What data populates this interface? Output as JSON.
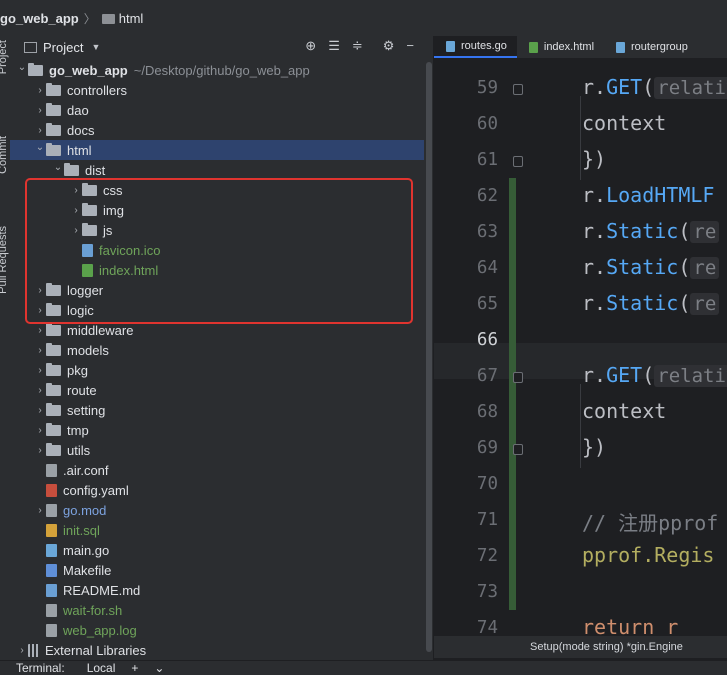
{
  "breadcrumb": {
    "project": "go_web_app",
    "folder": "html"
  },
  "side_strip": {
    "project_label": "Project",
    "commit_label": "Commit",
    "pull_label": "Pull Requests"
  },
  "project_panel": {
    "title": "Project",
    "tools": [
      "crosshair-icon",
      "expand-all-icon",
      "collapse-all-icon",
      "settings-icon"
    ],
    "tree": [
      {
        "indent": 0,
        "arrow": "open",
        "type": "folder",
        "label": "go_web_app",
        "bold": true,
        "suffix": "~/Desktop/github/go_web_app"
      },
      {
        "indent": 1,
        "arrow": "closed",
        "type": "folder",
        "label": "controllers"
      },
      {
        "indent": 1,
        "arrow": "closed",
        "type": "folder",
        "label": "dao"
      },
      {
        "indent": 1,
        "arrow": "closed",
        "type": "folder",
        "label": "docs"
      },
      {
        "indent": 1,
        "arrow": "open",
        "type": "folder",
        "label": "html",
        "selected": true
      },
      {
        "indent": 2,
        "arrow": "open",
        "type": "folder",
        "label": "dist"
      },
      {
        "indent": 3,
        "arrow": "closed",
        "type": "folder",
        "label": "css"
      },
      {
        "indent": 3,
        "arrow": "closed",
        "type": "folder",
        "label": "img"
      },
      {
        "indent": 3,
        "arrow": "closed",
        "type": "folder",
        "label": "js"
      },
      {
        "indent": 3,
        "arrow": "none",
        "type": "file",
        "label": "favicon.ico",
        "color": "green",
        "icon": "#6a9fd4"
      },
      {
        "indent": 3,
        "arrow": "none",
        "type": "file",
        "label": "index.html",
        "color": "green",
        "icon": "#5aa14b"
      },
      {
        "indent": 1,
        "arrow": "closed",
        "type": "folder",
        "label": "logger"
      },
      {
        "indent": 1,
        "arrow": "closed",
        "type": "folder",
        "label": "logic"
      },
      {
        "indent": 1,
        "arrow": "closed",
        "type": "folder",
        "label": "middleware"
      },
      {
        "indent": 1,
        "arrow": "closed",
        "type": "folder",
        "label": "models"
      },
      {
        "indent": 1,
        "arrow": "closed",
        "type": "folder",
        "label": "pkg"
      },
      {
        "indent": 1,
        "arrow": "closed",
        "type": "folder",
        "label": "route"
      },
      {
        "indent": 1,
        "arrow": "closed",
        "type": "folder",
        "label": "setting"
      },
      {
        "indent": 1,
        "arrow": "closed",
        "type": "folder",
        "label": "tmp"
      },
      {
        "indent": 1,
        "arrow": "closed",
        "type": "folder",
        "label": "utils"
      },
      {
        "indent": 1,
        "arrow": "none",
        "type": "file",
        "label": ".air.conf",
        "icon": "#9aa0a6"
      },
      {
        "indent": 1,
        "arrow": "none",
        "type": "file",
        "label": "config.yaml",
        "icon": "#c74e3d"
      },
      {
        "indent": 1,
        "arrow": "closed",
        "type": "file",
        "label": "go.mod",
        "color": "blue",
        "icon": "#9aa0a6"
      },
      {
        "indent": 1,
        "arrow": "none",
        "type": "file",
        "label": "init.sql",
        "color": "green",
        "icon": "#d4a23a"
      },
      {
        "indent": 1,
        "arrow": "none",
        "type": "file",
        "label": "main.go",
        "icon": "#6aa7d8"
      },
      {
        "indent": 1,
        "arrow": "none",
        "type": "file",
        "label": "Makefile",
        "icon": "#5f8fd8"
      },
      {
        "indent": 1,
        "arrow": "none",
        "type": "file",
        "label": "README.md",
        "icon": "#6a9fd4"
      },
      {
        "indent": 1,
        "arrow": "none",
        "type": "file",
        "label": "wait-for.sh",
        "color": "green",
        "icon": "#9aa0a6"
      },
      {
        "indent": 1,
        "arrow": "none",
        "type": "file",
        "label": "web_app.log",
        "color": "green",
        "icon": "#9aa0a6"
      },
      {
        "indent": 0,
        "arrow": "closed",
        "type": "lib",
        "label": "External Libraries"
      }
    ]
  },
  "editor": {
    "tabs": [
      {
        "label": "routes.go",
        "active": true,
        "icon": "#6aa7d8"
      },
      {
        "label": "index.html",
        "active": false,
        "icon": "#5aa14b"
      },
      {
        "label": "routergroup",
        "active": false,
        "icon": "#6aa7d8"
      }
    ],
    "line_numbers": [
      "59",
      "60",
      "61",
      "62",
      "63",
      "64",
      "65",
      "66",
      "67",
      "68",
      "69",
      "70",
      "71",
      "72",
      "73",
      "74"
    ],
    "current_line": "66",
    "lines": [
      [
        {
          "t": "r.",
          "c": ""
        },
        {
          "t": "GET",
          "c": "fn"
        },
        {
          "t": "(",
          "c": ""
        },
        {
          "t": "relativ",
          "c": "hint"
        }
      ],
      [
        {
          "t": "    context",
          "c": ""
        }
      ],
      [
        {
          "t": "})",
          "c": ""
        }
      ],
      [
        {
          "t": "r.",
          "c": ""
        },
        {
          "t": "LoadHTMLF",
          "c": "fn"
        }
      ],
      [
        {
          "t": "r.",
          "c": ""
        },
        {
          "t": "Static",
          "c": "fn"
        },
        {
          "t": "(",
          "c": ""
        },
        {
          "t": "re",
          "c": "hint"
        }
      ],
      [
        {
          "t": "r.",
          "c": ""
        },
        {
          "t": "Static",
          "c": "fn"
        },
        {
          "t": "(",
          "c": ""
        },
        {
          "t": "re",
          "c": "hint"
        }
      ],
      [
        {
          "t": "r.",
          "c": ""
        },
        {
          "t": "Static",
          "c": "fn"
        },
        {
          "t": "(",
          "c": ""
        },
        {
          "t": "re",
          "c": "hint"
        }
      ],
      [],
      [
        {
          "t": "r.",
          "c": ""
        },
        {
          "t": "GET",
          "c": "fn"
        },
        {
          "t": "(",
          "c": ""
        },
        {
          "t": "relativ",
          "c": "hint"
        }
      ],
      [
        {
          "t": "    context",
          "c": ""
        }
      ],
      [
        {
          "t": "})",
          "c": ""
        }
      ],
      [],
      [
        {
          "t": "// 注册pprof",
          "c": "cm"
        }
      ],
      [
        {
          "t": "pprof.",
          "c": "yl"
        },
        {
          "t": "Regis",
          "c": "yl"
        }
      ],
      [],
      [
        {
          "t": "return r",
          "c": "kw"
        }
      ]
    ],
    "bottom_hint": "Setup(mode string) *gin.Engine"
  },
  "bottom_bar": {
    "terminal_label": "Terminal:",
    "tab_label": "Local",
    "add": "+",
    "more": "⌄"
  }
}
